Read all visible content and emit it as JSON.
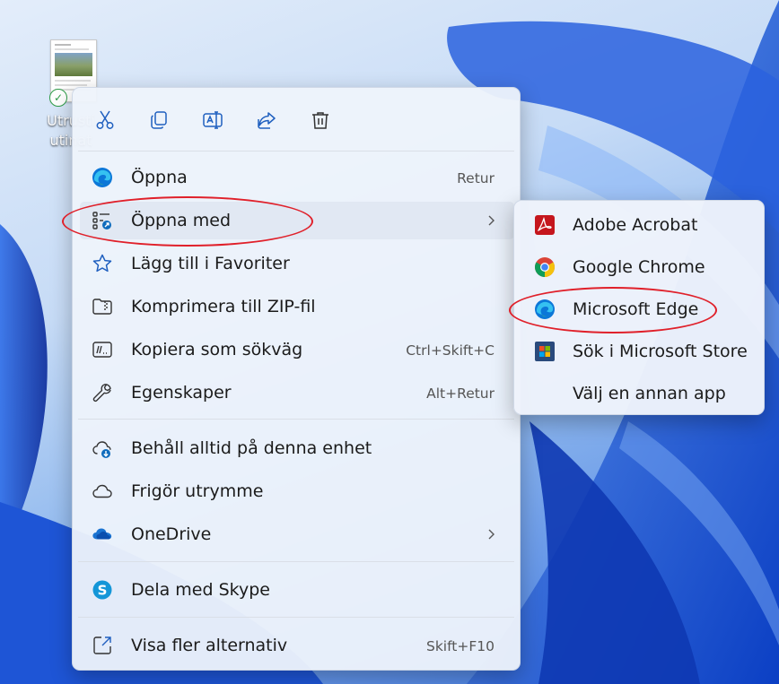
{
  "desktop": {
    "file_label_line1": "Utrusti",
    "file_label_line2": "utinat"
  },
  "context_menu": {
    "toolbar": [
      {
        "name": "cut-icon"
      },
      {
        "name": "copy-icon"
      },
      {
        "name": "rename-icon"
      },
      {
        "name": "share-icon"
      },
      {
        "name": "delete-icon"
      }
    ],
    "items": [
      {
        "label": "Öppna",
        "shortcut": "Retur",
        "icon": "edge-icon"
      },
      {
        "label": "Öppna med",
        "shortcut": "",
        "icon": "open-with-icon",
        "has_submenu": true
      },
      {
        "label": "Lägg till i Favoriter",
        "shortcut": "",
        "icon": "star-icon"
      },
      {
        "label": "Komprimera till ZIP-fil",
        "shortcut": "",
        "icon": "zip-folder-icon"
      },
      {
        "label": "Kopiera som sökväg",
        "shortcut": "Ctrl+Skift+C",
        "icon": "copy-path-icon"
      },
      {
        "label": "Egenskaper",
        "shortcut": "Alt+Retur",
        "icon": "wrench-icon"
      },
      {
        "label": "Behåll alltid på denna enhet",
        "shortcut": "",
        "icon": "cloud-download-icon"
      },
      {
        "label": "Frigör utrymme",
        "shortcut": "",
        "icon": "cloud-outline-icon"
      },
      {
        "label": "OneDrive",
        "shortcut": "",
        "icon": "onedrive-icon",
        "has_submenu": true
      },
      {
        "label": "Dela med Skype",
        "shortcut": "",
        "icon": "skype-icon"
      },
      {
        "label": "Visa fler alternativ",
        "shortcut": "Skift+F10",
        "icon": "more-options-icon"
      }
    ]
  },
  "submenu": {
    "items": [
      {
        "label": "Adobe Acrobat",
        "icon": "acrobat-icon"
      },
      {
        "label": "Google Chrome",
        "icon": "chrome-icon"
      },
      {
        "label": "Microsoft Edge",
        "icon": "edge-icon"
      },
      {
        "label": "Sök i Microsoft Store",
        "icon": "store-icon"
      },
      {
        "label": "Välj en annan app",
        "icon": ""
      }
    ]
  },
  "colors": {
    "accent": "#0f6cbd",
    "highlight_circle": "#e0202a",
    "acrobat": "#c5161d",
    "onedrive": "#1a73d1",
    "skype": "#1496d8"
  }
}
